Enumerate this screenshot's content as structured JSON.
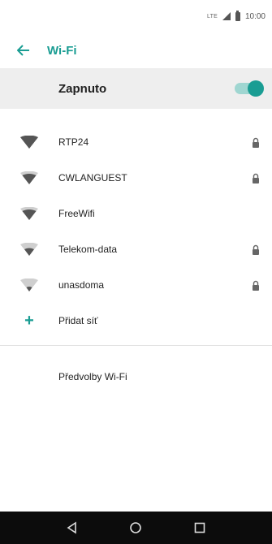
{
  "status_bar": {
    "network": "LTE",
    "time": "10:00"
  },
  "app_bar": {
    "title": "Wi-Fi",
    "back_icon": "arrow-left-icon"
  },
  "master_toggle": {
    "label": "Zapnuto",
    "on": true
  },
  "networks": [
    {
      "name": "RTP24",
      "secured": true,
      "strength": 4
    },
    {
      "name": "CWLANGUEST",
      "secured": true,
      "strength": 3
    },
    {
      "name": "FreeWifi",
      "secured": false,
      "strength": 3
    },
    {
      "name": "Telekom-data",
      "secured": true,
      "strength": 2
    },
    {
      "name": "unasdoma",
      "secured": true,
      "strength": 1
    }
  ],
  "add_network": {
    "label": "Přidat síť"
  },
  "preferences": {
    "label": "Předvolby Wi-Fi"
  },
  "colors": {
    "accent": "#1a9d93",
    "toggle_bg": "#eeeeee",
    "nav_bg": "#0c0c0c"
  }
}
